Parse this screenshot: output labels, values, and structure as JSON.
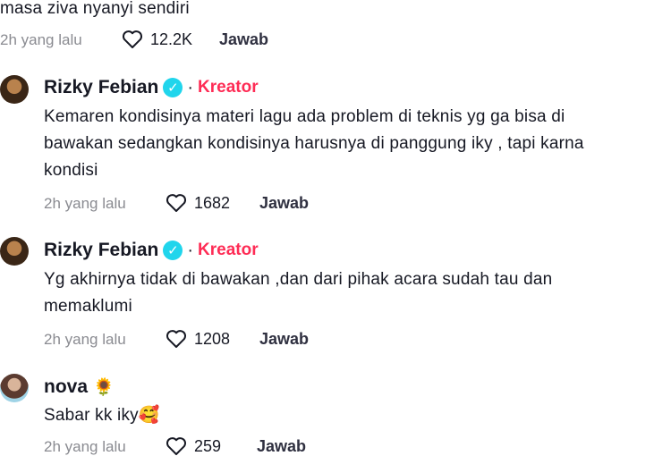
{
  "top_comment": {
    "text": "masa ziva nyanyi sendiri",
    "time": "2h yang lalu",
    "likes": "12.2K",
    "reply": "Jawab"
  },
  "replies": [
    {
      "name": "Rizky Febian",
      "badge": "Kreator",
      "lines": [
        "Kemaren kondisinya materi lagu ada problem di teknis yg ga bisa di",
        "bawakan sedangkan kondisinya harusnya di panggung iky , tapi karna",
        "kondisi"
      ],
      "time": "2h yang lalu",
      "likes": "1682",
      "reply": "Jawab"
    },
    {
      "name": "Rizky Febian",
      "badge": "Kreator",
      "lines": [
        "Yg akhirnya tidak di bawakan ,dan dari pihak acara sudah tau dan",
        "memaklumi"
      ],
      "time": "2h yang lalu",
      "likes": "1208",
      "reply": "Jawab"
    },
    {
      "name": "nova",
      "name_emoji": "🌻",
      "lines": [
        "Sabar kk iky🥰"
      ],
      "time": "2h yang lalu",
      "likes": "259",
      "reply": "Jawab"
    }
  ]
}
